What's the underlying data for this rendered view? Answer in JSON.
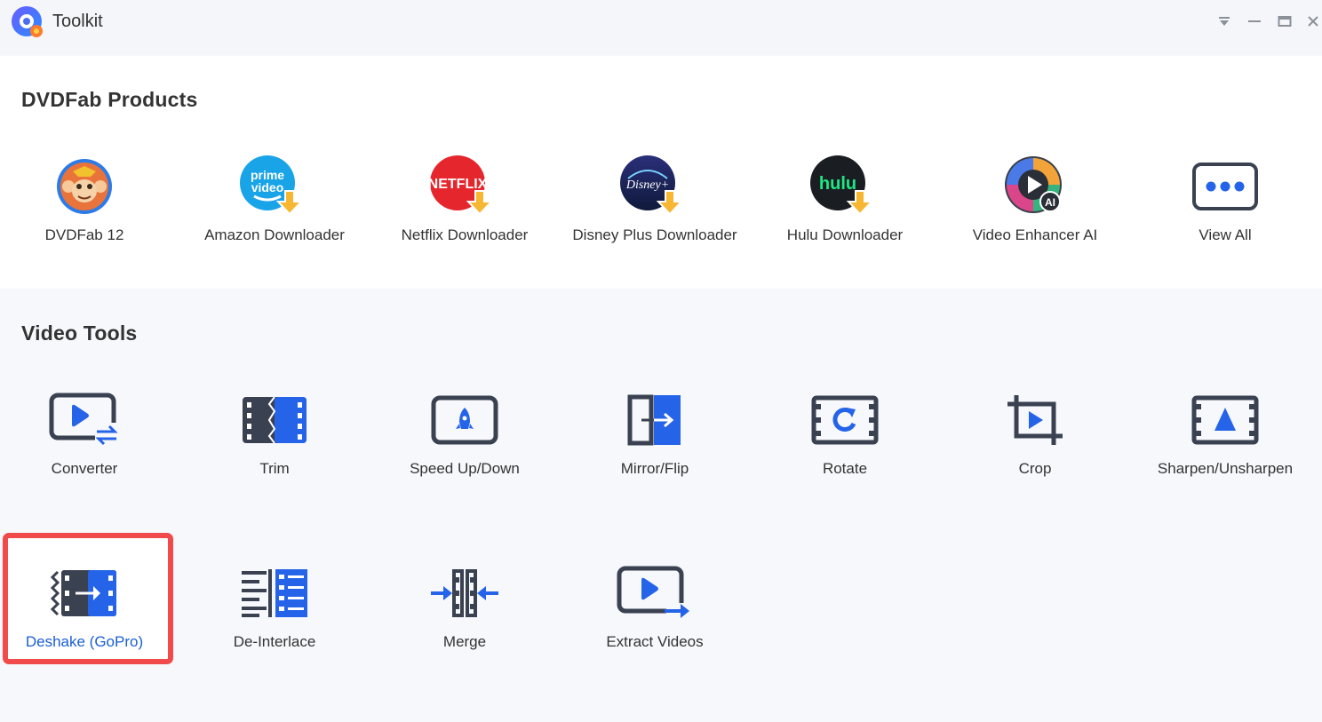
{
  "window": {
    "title": "Toolkit",
    "controls": [
      "settings-dropdown",
      "minimize",
      "maximize",
      "close"
    ]
  },
  "products": {
    "heading": "DVDFab Products",
    "items": [
      {
        "label": "DVDFab 12",
        "icon": "dvdfab-monkey-icon"
      },
      {
        "label": "Amazon Downloader",
        "icon": "prime-video-icon"
      },
      {
        "label": "Netflix Downloader",
        "icon": "netflix-icon"
      },
      {
        "label": "Disney Plus Downloader",
        "icon": "disney-plus-icon"
      },
      {
        "label": "Hulu Downloader",
        "icon": "hulu-icon"
      },
      {
        "label": "Video Enhancer AI",
        "icon": "video-enhancer-ai-icon"
      },
      {
        "label": "View All",
        "icon": "more-dots-icon"
      }
    ],
    "badge_texts": {
      "prime": "prime",
      "video": "video",
      "netflix": "NETFLIX",
      "disney": "Disney+",
      "hulu": "hulu",
      "ai": "AI"
    }
  },
  "video_tools": {
    "heading": "Video Tools",
    "items": [
      {
        "label": "Converter",
        "icon": "converter-icon"
      },
      {
        "label": "Trim",
        "icon": "trim-icon"
      },
      {
        "label": "Speed Up/Down",
        "icon": "speed-icon"
      },
      {
        "label": "Mirror/Flip",
        "icon": "mirror-flip-icon"
      },
      {
        "label": "Rotate",
        "icon": "rotate-icon"
      },
      {
        "label": "Crop",
        "icon": "crop-icon"
      },
      {
        "label": "Sharpen/Unsharpen",
        "icon": "sharpen-icon"
      },
      {
        "label": "Deshake (GoPro)",
        "icon": "deshake-icon",
        "selected": true
      },
      {
        "label": "De-Interlace",
        "icon": "deinterlace-icon"
      },
      {
        "label": "Merge",
        "icon": "merge-icon"
      },
      {
        "label": "Extract Videos",
        "icon": "extract-videos-icon"
      }
    ]
  },
  "colors": {
    "accent": "#2563e8",
    "dark_icon": "#3a4150",
    "download_arrow": "#f7b733",
    "highlight": "#f04a4a",
    "selected_label": "#1a5fd1"
  }
}
